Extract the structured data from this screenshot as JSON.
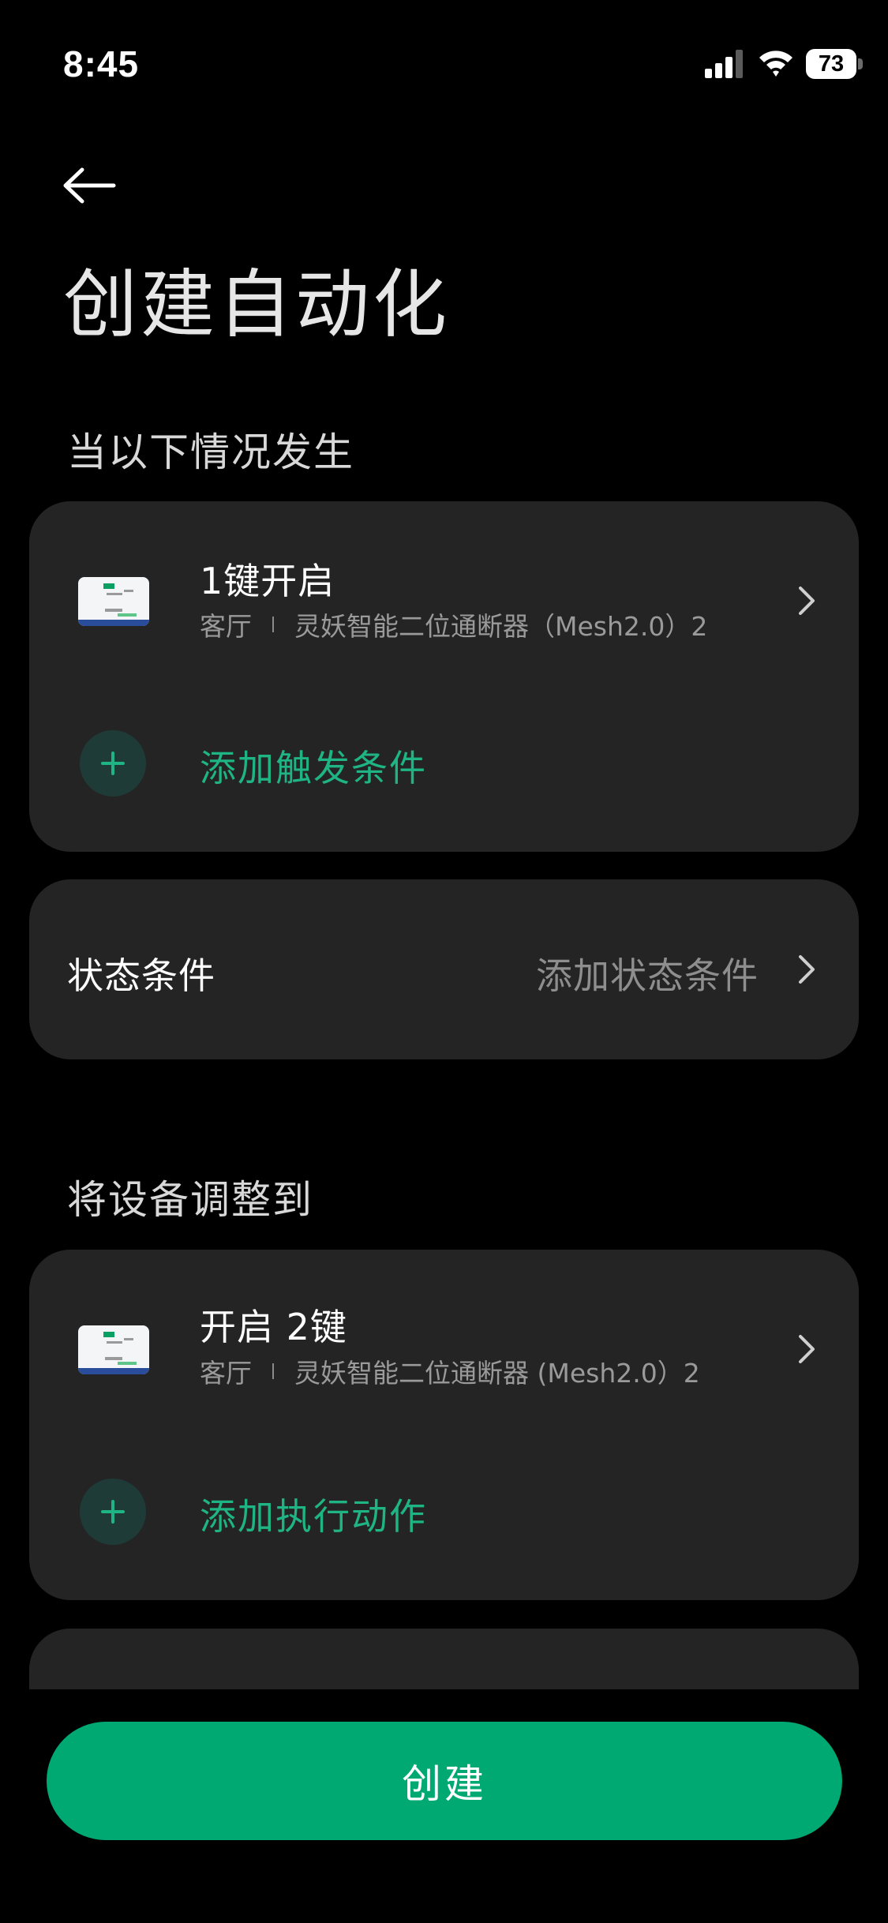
{
  "status_bar": {
    "time": "8:45",
    "battery": "73"
  },
  "header": {
    "title": "创建自动化"
  },
  "trigger_section": {
    "label": "当以下情况发生",
    "item": {
      "title": "1键开启",
      "room": "客厅",
      "device": "灵妖智能二位通断器（Mesh2.0）2"
    },
    "add_label": "添加触发条件"
  },
  "condition_section": {
    "label": "状态条件",
    "value": "添加状态条件"
  },
  "action_section": {
    "label": "将设备调整到",
    "item": {
      "title": "开启 2键",
      "room": "客厅",
      "device": "灵妖智能二位通断器 (Mesh2.0）2"
    },
    "add_label": "添加执行动作"
  },
  "footer": {
    "create_label": "创建"
  },
  "colors": {
    "accent": "#00a872",
    "accent_text": "#1fb483",
    "card": "#242424",
    "background": "#000000"
  }
}
